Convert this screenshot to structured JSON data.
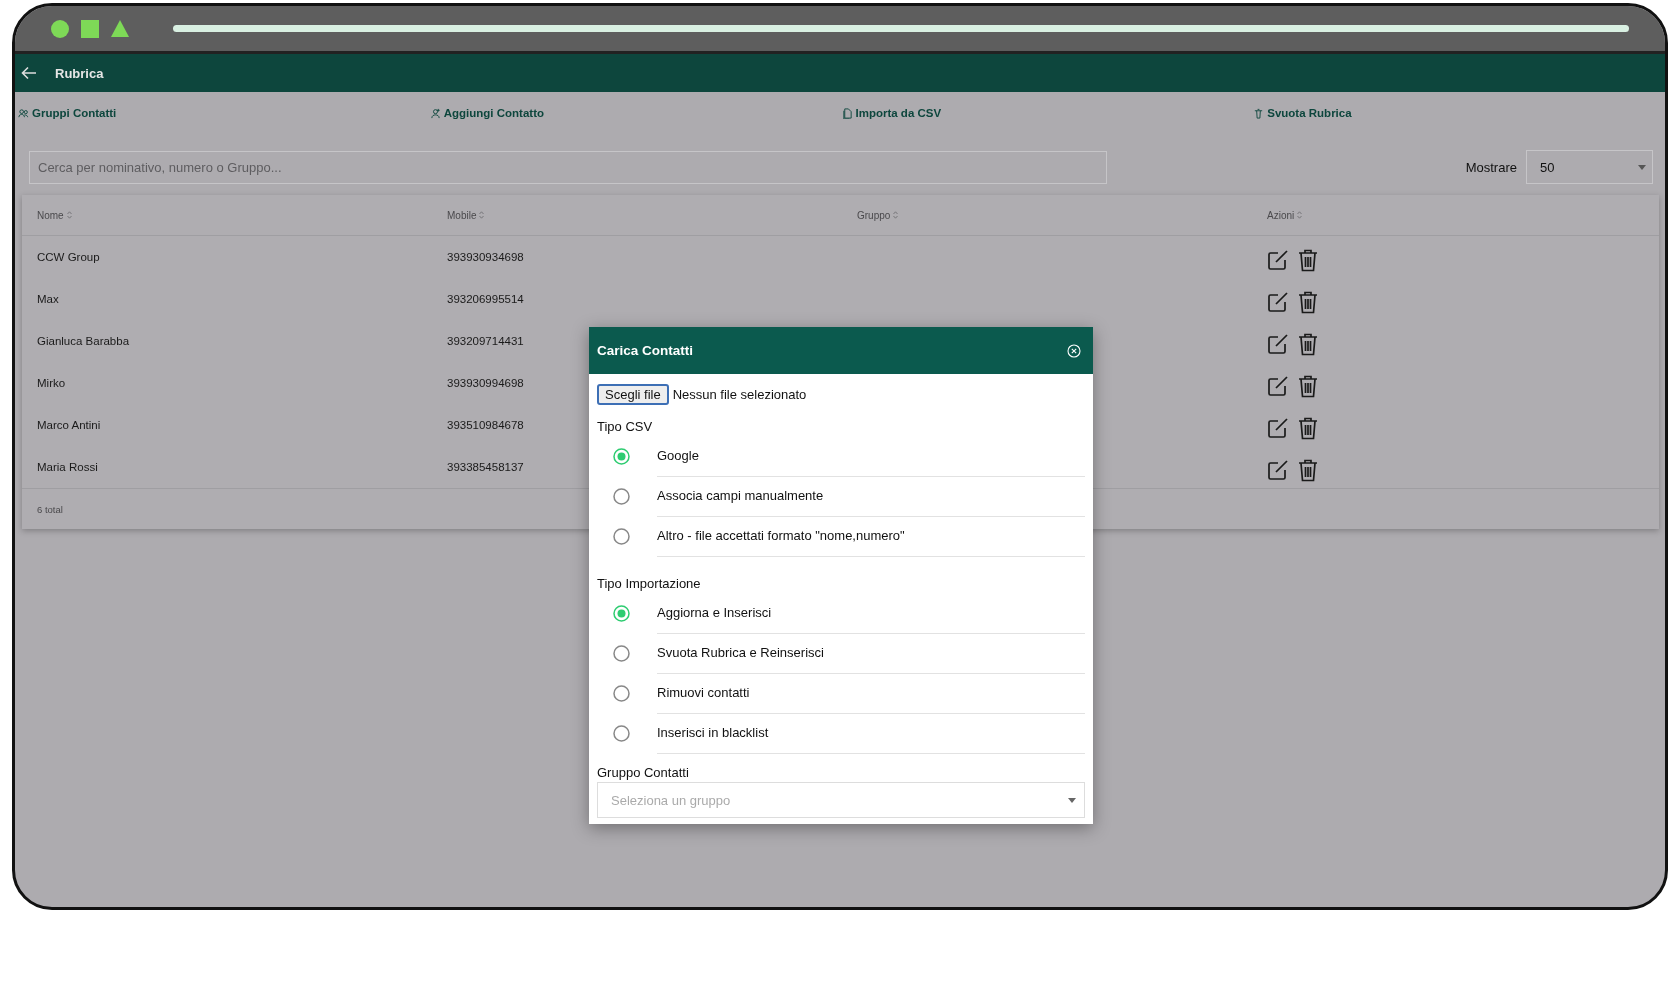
{
  "header": {
    "title": "Rubrica"
  },
  "toolbar": [
    {
      "label": "Gruppi Contatti"
    },
    {
      "label": "Aggiungi Contatto"
    },
    {
      "label": "Importa da CSV"
    },
    {
      "label": "Svuota Rubrica"
    }
  ],
  "search": {
    "placeholder": "Cerca per nominativo, numero o Gruppo..."
  },
  "page_size": {
    "label": "Mostrare",
    "value": "50"
  },
  "table": {
    "columns": [
      "Nome",
      "Mobile",
      "Gruppo",
      "Azioni"
    ],
    "rows": [
      {
        "name": "CCW Group",
        "mobile": "393930934698"
      },
      {
        "name": "Max",
        "mobile": "393206995514"
      },
      {
        "name": "Gianluca Barabba",
        "mobile": "393209714431"
      },
      {
        "name": "Mirko",
        "mobile": "393930994698"
      },
      {
        "name": "Marco Antini",
        "mobile": "393510984678"
      },
      {
        "name": "Maria Rossi",
        "mobile": "393385458137"
      }
    ],
    "footer": "6 total"
  },
  "modal": {
    "title": "Carica Contatti",
    "file_input": {
      "button": "Scegli file",
      "status": "Nessun file selezionato"
    },
    "sections": [
      {
        "label": "Tipo CSV",
        "options": [
          {
            "label": "Google",
            "selected": true
          },
          {
            "label": "Associa campi manualmente",
            "selected": false
          },
          {
            "label": "Altro - file accettati formato \"nome,numero\"",
            "selected": false
          }
        ]
      },
      {
        "label": "Tipo Importazione",
        "options": [
          {
            "label": "Aggiorna e Inserisci",
            "selected": true
          },
          {
            "label": "Svuota Rubrica e Reinserisci",
            "selected": false
          },
          {
            "label": "Rimuovi contatti",
            "selected": false
          },
          {
            "label": "Inserisci in blacklist",
            "selected": false
          }
        ]
      }
    ],
    "group": {
      "label": "Gruppo Contatti",
      "placeholder": "Seleziona un gruppo"
    }
  }
}
